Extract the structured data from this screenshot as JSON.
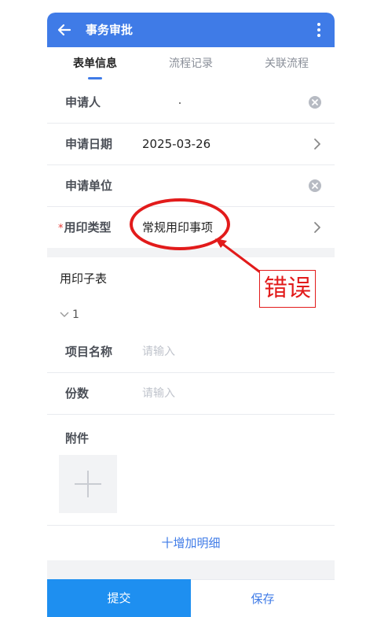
{
  "header": {
    "title": "事务审批"
  },
  "tabs": [
    {
      "label": "表单信息",
      "active": true
    },
    {
      "label": "流程记录",
      "active": false
    },
    {
      "label": "关联流程",
      "active": false
    }
  ],
  "form": {
    "applicant_label": "申请人",
    "apply_date_label": "申请日期",
    "apply_date_value": "2025-03-26",
    "apply_unit_label": "申请单位",
    "required_mark": "*",
    "seal_type_label": "用印类型",
    "seal_type_value": "常规用印事项"
  },
  "subtable": {
    "title": "用印子表",
    "group_index": "1",
    "project_name_label": "项目名称",
    "project_name_placeholder": "请输入",
    "copies_label": "份数",
    "copies_placeholder": "请输入",
    "attachment_label": "附件",
    "add_detail": "十增加明细"
  },
  "footer": {
    "submit": "提交",
    "save": "保存"
  },
  "annotation": {
    "text": "错误",
    "color": "#e21b1b"
  },
  "colors": {
    "primary": "#3f7be7",
    "submit_bg": "#1e8ff0"
  },
  "icons": [
    "back-arrow-icon",
    "more-vertical-icon",
    "clear-icon",
    "chevron-right-icon",
    "chevron-down-icon",
    "plus-icon"
  ]
}
